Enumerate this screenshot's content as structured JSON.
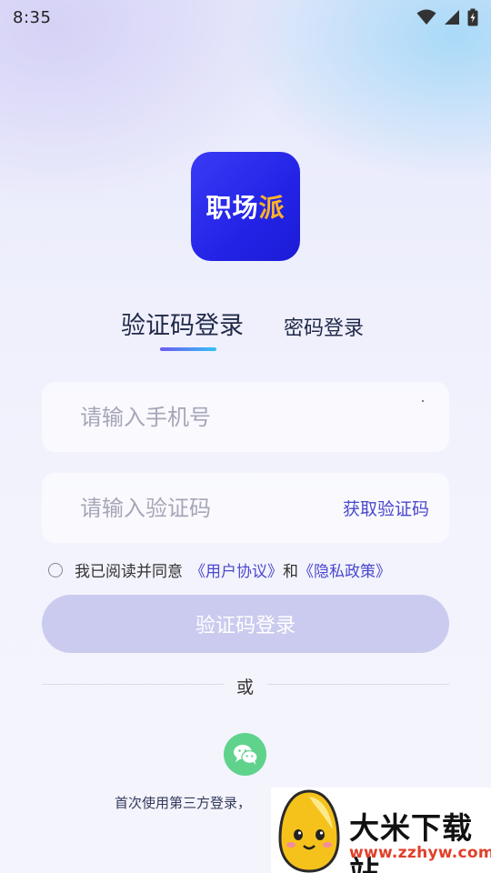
{
  "status_bar": {
    "time": "8:35",
    "icons": [
      "wifi-icon",
      "signal-icon",
      "battery-icon"
    ]
  },
  "logo": {
    "text_main": "职场",
    "text_accent": "派",
    "bg_color": "#2a2af0",
    "accent_color": "#ffb327"
  },
  "tabs": {
    "active": "验证码登录",
    "inactive": "密码登录"
  },
  "form": {
    "phone_placeholder": "请输入手机号",
    "code_placeholder": "请输入验证码",
    "get_code_label": "获取验证码"
  },
  "agreement": {
    "prefix": "我已阅读并同意",
    "user_agreement": "《用户协议》",
    "conjunction": "和",
    "privacy_policy": "《隐私政策》"
  },
  "login_button": "验证码登录",
  "divider_text": "或",
  "third_party": {
    "note": "首次使用第三方登录，",
    "wechat_icon": "wechat-icon",
    "wechat_color": "#5fd38c"
  },
  "watermark": {
    "title": "大米下载站",
    "url": "www.zzhyw.com"
  },
  "colors": {
    "accent": "#4a48cc",
    "button_disabled": "#cbcbef"
  }
}
